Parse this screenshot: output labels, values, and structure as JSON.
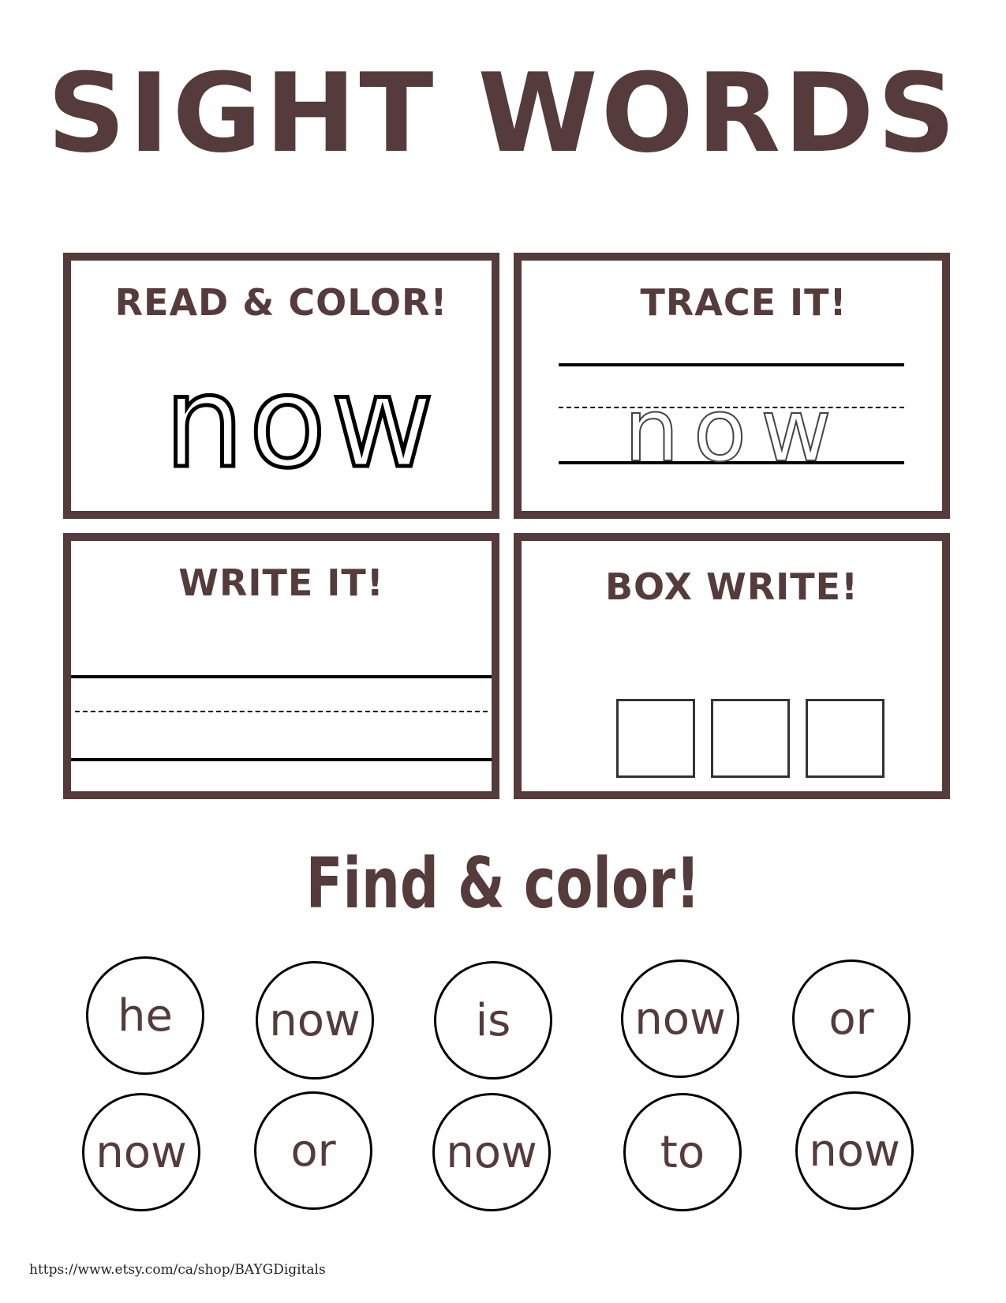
{
  "title": "SIGHT WORDS",
  "panels": {
    "read_color": {
      "title": "READ & COLOR!",
      "word": "now"
    },
    "trace": {
      "title": "TRACE IT!",
      "word": "now"
    },
    "write": {
      "title": "WRITE IT!"
    },
    "box_write": {
      "title": "BOX WRITE!"
    }
  },
  "find": {
    "title": "Find & color!",
    "words": [
      "he",
      "now",
      "is",
      "now",
      "or",
      "now",
      "or",
      "now",
      "to",
      "now"
    ]
  },
  "footer": "https://www.etsy.com/ca/shop/BAYGDigitals",
  "colors": {
    "accent": "#553b3b"
  }
}
